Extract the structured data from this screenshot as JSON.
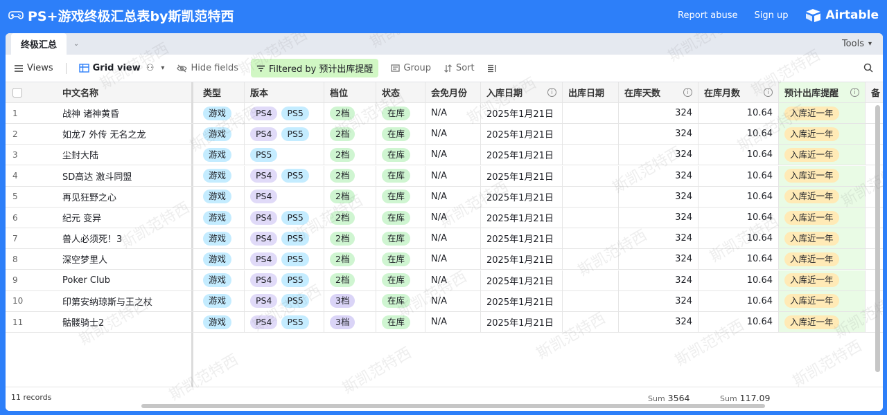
{
  "header": {
    "title": "PS+游戏终极汇总表by斯凯范特西",
    "report_abuse": "Report abuse",
    "sign_up": "Sign up",
    "brand": "Airtable"
  },
  "tabs": {
    "active": "终极汇总",
    "tools": "Tools"
  },
  "toolbar": {
    "views": "Views",
    "grid_view": "Grid view",
    "hide_fields": "Hide fields",
    "filter": "Filtered by 预计出库提醒",
    "group": "Group",
    "sort": "Sort"
  },
  "columns": [
    "中文名称",
    "类型",
    "版本",
    "档位",
    "状态",
    "会免月份",
    "入库日期",
    "出库日期",
    "在库天数",
    "在库月数",
    "预计出库提醒",
    "备"
  ],
  "rows": [
    {
      "n": "1",
      "name": "战神 诸神黄昏",
      "type": "游戏",
      "ver": [
        "PS4",
        "PS5"
      ],
      "tier": "2档",
      "status": "在库",
      "month": "N/A",
      "in": "2025年1月21日",
      "out": "",
      "days": "324",
      "months": "10.64",
      "remind": "入库近一年"
    },
    {
      "n": "2",
      "name": "如龙7 外传 无名之龙",
      "type": "游戏",
      "ver": [
        "PS4",
        "PS5"
      ],
      "tier": "2档",
      "status": "在库",
      "month": "N/A",
      "in": "2025年1月21日",
      "out": "",
      "days": "324",
      "months": "10.64",
      "remind": "入库近一年"
    },
    {
      "n": "3",
      "name": "尘封大陆",
      "type": "游戏",
      "ver": [
        "PS5"
      ],
      "tier": "2档",
      "status": "在库",
      "month": "N/A",
      "in": "2025年1月21日",
      "out": "",
      "days": "324",
      "months": "10.64",
      "remind": "入库近一年"
    },
    {
      "n": "4",
      "name": "SD高达 激斗同盟",
      "type": "游戏",
      "ver": [
        "PS4",
        "PS5"
      ],
      "tier": "2档",
      "status": "在库",
      "month": "N/A",
      "in": "2025年1月21日",
      "out": "",
      "days": "324",
      "months": "10.64",
      "remind": "入库近一年"
    },
    {
      "n": "5",
      "name": "再见狂野之心",
      "type": "游戏",
      "ver": [
        "PS4"
      ],
      "tier": "2档",
      "status": "在库",
      "month": "N/A",
      "in": "2025年1月21日",
      "out": "",
      "days": "324",
      "months": "10.64",
      "remind": "入库近一年"
    },
    {
      "n": "6",
      "name": "纪元 变异",
      "type": "游戏",
      "ver": [
        "PS4",
        "PS5"
      ],
      "tier": "2档",
      "status": "在库",
      "month": "N/A",
      "in": "2025年1月21日",
      "out": "",
      "days": "324",
      "months": "10.64",
      "remind": "入库近一年"
    },
    {
      "n": "7",
      "name": "兽人必须死！3",
      "type": "游戏",
      "ver": [
        "PS4",
        "PS5"
      ],
      "tier": "2档",
      "status": "在库",
      "month": "N/A",
      "in": "2025年1月21日",
      "out": "",
      "days": "324",
      "months": "10.64",
      "remind": "入库近一年"
    },
    {
      "n": "8",
      "name": "深空梦里人",
      "type": "游戏",
      "ver": [
        "PS4",
        "PS5"
      ],
      "tier": "2档",
      "status": "在库",
      "month": "N/A",
      "in": "2025年1月21日",
      "out": "",
      "days": "324",
      "months": "10.64",
      "remind": "入库近一年"
    },
    {
      "n": "9",
      "name": "Poker Club",
      "type": "游戏",
      "ver": [
        "PS4",
        "PS5"
      ],
      "tier": "2档",
      "status": "在库",
      "month": "N/A",
      "in": "2025年1月21日",
      "out": "",
      "days": "324",
      "months": "10.64",
      "remind": "入库近一年"
    },
    {
      "n": "10",
      "name": "印第安纳琼斯与王之杖",
      "type": "游戏",
      "ver": [
        "PS4",
        "PS5"
      ],
      "tier": "3档",
      "status": "在库",
      "month": "N/A",
      "in": "2025年1月21日",
      "out": "",
      "days": "324",
      "months": "10.64",
      "remind": "入库近一年"
    },
    {
      "n": "11",
      "name": "骷髅骑士2",
      "type": "游戏",
      "ver": [
        "PS4",
        "PS5"
      ],
      "tier": "3档",
      "status": "在库",
      "month": "N/A",
      "in": "2025年1月21日",
      "out": "",
      "days": "324",
      "months": "10.64",
      "remind": "入库近一年"
    }
  ],
  "footer": {
    "records": "11 records",
    "sum_label": "Sum",
    "sum_days": "3564",
    "sum_months": "117.09"
  },
  "watermark": "斯凯范特西",
  "colors": {
    "accent": "#2d7ff9",
    "filter_bg": "#d1f7c4",
    "highlight_col": "#e9fbe5"
  }
}
